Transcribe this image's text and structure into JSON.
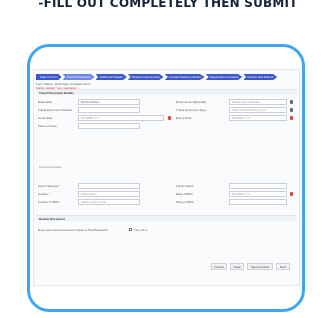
{
  "heading": "-FILL OUT COMPLETELY THEN SUBMIT",
  "steps": [
    "Start of Form",
    "Travel Information",
    "Additional Details",
    "Passport Documents",
    "Contact Address Details",
    "Registration Contacts",
    "Review and Submit"
  ],
  "info": {
    "line1": "Form Status - Draft  Save Complete Form",
    "line2": "Fields marked * are mandatory"
  },
  "sections": {
    "travel": "Travel Document Details",
    "applicant": "Applicant Details",
    "review": "Review Document"
  },
  "travel_fields": {
    "nationality_label": "Nationality",
    "nationality_value": "BANGLADESH",
    "document_number_label": "Travel Document Number",
    "issue_date_label": "Issue Date",
    "issue_date_placeholder": "DD-MMM-YYYY",
    "place_of_issue_label": "Place of Issue",
    "nationality2_label": "Document's Nationality",
    "nationality2_placeholder": "Please select nationality",
    "document_type_label": "Travel Document Type",
    "document_type_placeholder": "Select a travel document type",
    "expiry_label": "Expiry Date",
    "expiry_placeholder": "DD-MMM-YYYY"
  },
  "applicant_fields": {
    "surname_label": "Given Name(s) *",
    "gender_label": "Gender *",
    "gender_placeholder": "Please select",
    "country_birth_label": "Country of Birth",
    "country_birth_placeholder": "Select country of birth",
    "family_label": "Family Name",
    "dob_label": "Date of Birth",
    "dob_placeholder": "DD-MMM-YYYY",
    "place_birth_label": "Place of Birth"
  },
  "review": {
    "question": "Does your travel document contain a Thai Passport?",
    "checkbox_label": "Yes, tick it"
  },
  "buttons": [
    "Cancel",
    "Clear",
    "Save and Exit",
    "Next"
  ]
}
